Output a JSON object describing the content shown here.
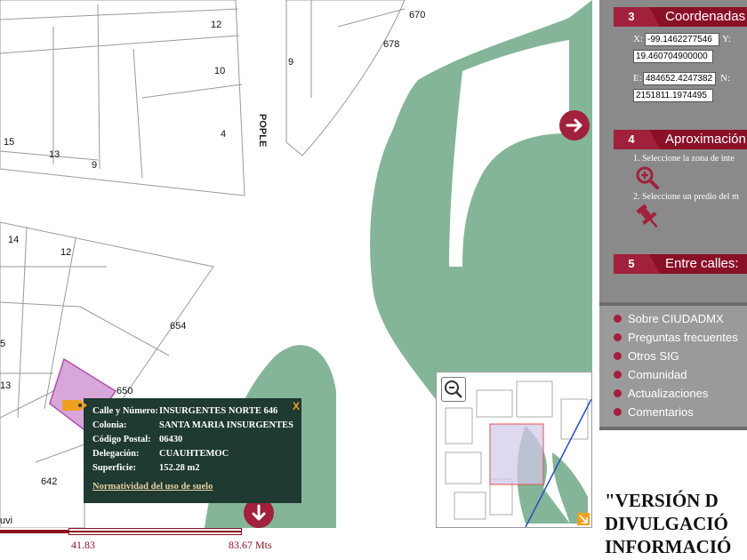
{
  "map": {
    "lot_numbers": [
      "670",
      "678",
      "12",
      "10",
      "9",
      "4",
      "15",
      "13",
      "9",
      "14",
      "12",
      "654",
      "5",
      "650",
      "13",
      "642"
    ],
    "street_label": "POPLE",
    "edge_label": "uvi"
  },
  "popup": {
    "fields": [
      {
        "key": "Calle y Número:",
        "value": "INSURGENTES NORTE 646"
      },
      {
        "key": "Colonia:",
        "value": "SANTA MARIA INSURGENTES"
      },
      {
        "key": "Código Postal:",
        "value": "06430"
      },
      {
        "key": "Delegación:",
        "value": "CUAUHTEMOC"
      },
      {
        "key": "Superficie:",
        "value": "152.28 m2"
      }
    ],
    "link": "Normatividad del uso de suelo",
    "close": "X"
  },
  "scale": {
    "mid_label": "41.83",
    "end_label": "83.67 Mts"
  },
  "sidebar": {
    "sections": [
      {
        "num": "3",
        "title": "Coordenadas"
      },
      {
        "num": "4",
        "title": "Aproximación"
      },
      {
        "num": "5",
        "title": "Entre calles:"
      }
    ],
    "coords": {
      "x_label": "X:",
      "x_value": "-99.1462277546",
      "y_label": "Y:",
      "y_value": "19.460704900000",
      "e_label": "E:",
      "e_value": "484652.4247382",
      "n_label": "N:",
      "n_value": "2151811.1974495"
    },
    "approx": {
      "step1": "1. Seleccione la zona de inte",
      "step2": "2. Seleccione un predio del m"
    },
    "links": [
      "Sobre CIUDADMX",
      "Preguntas frecuentes",
      "Otros SIG",
      "Comunidad",
      "Actualizaciones",
      "Comentarios"
    ],
    "version_lines": [
      "\"VERSIÓN D",
      "DIVULGACIÓ",
      "INFORMACIÓ"
    ]
  },
  "colors": {
    "accent": "#a1203c",
    "park": "#85b598",
    "popup_bg": "#1f3a30",
    "sidebar_bg": "#8a8a8a",
    "selected_lot": "#d9a6d9"
  }
}
